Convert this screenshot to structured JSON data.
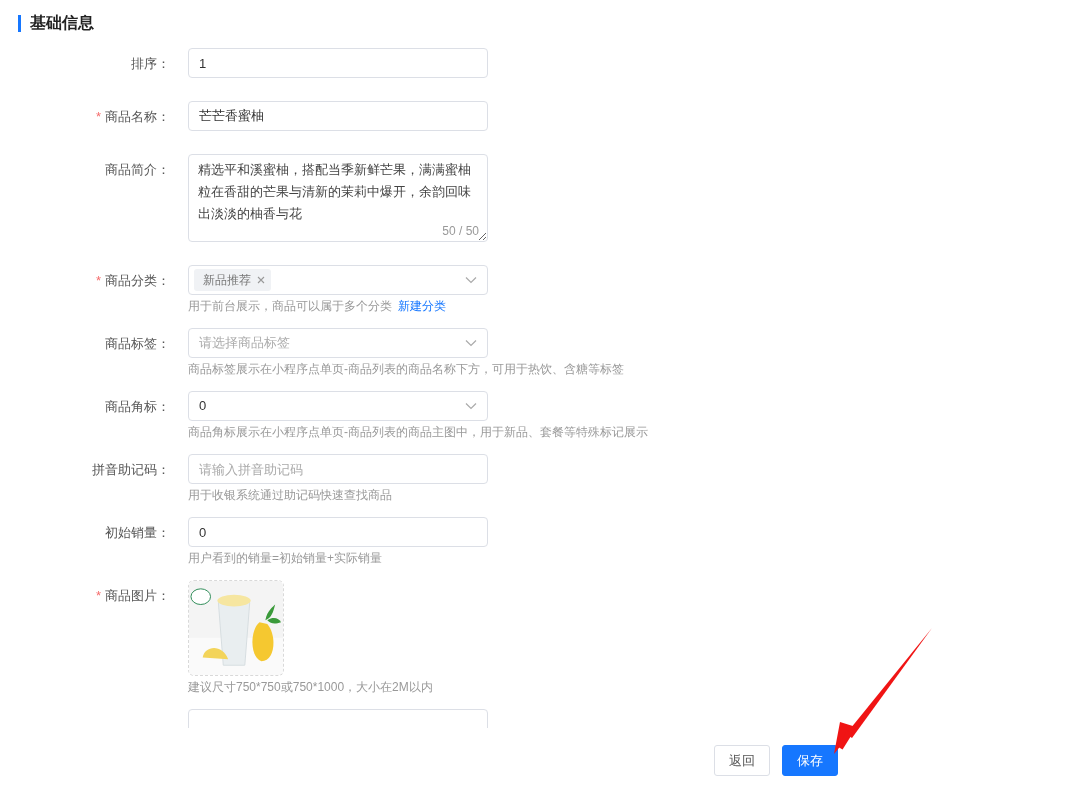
{
  "section_title": "基础信息",
  "fields": [
    {
      "kind": "input",
      "label": "排序：",
      "value": "1"
    },
    {
      "kind": "input",
      "required_mark": "*",
      "label": "商品名称：",
      "value": "芒芒香蜜柚"
    },
    {
      "kind": "textarea",
      "label": "商品简介：",
      "value": "精选平和溪蜜柚，搭配当季新鲜芒果，满满蜜柚粒在香甜的芒果与清新的茉莉中爆开，余韵回味出淡淡的柚香与花",
      "counter": "50 / 50"
    },
    {
      "kind": "tags",
      "required_mark": "*",
      "label": "商品分类：",
      "tags": [
        "新品推荐"
      ],
      "hint": "用于前台展示，商品可以属于多个分类",
      "hint_link": "新建分类"
    },
    {
      "kind": "select",
      "label": "商品标签：",
      "placeholder": "请选择商品标签",
      "hint": "商品标签展示在小程序点单页-商品列表的商品名称下方，可用于热饮、含糖等标签"
    },
    {
      "kind": "select",
      "label": "商品角标：",
      "value": "0",
      "hint": "商品角标展示在小程序点单页-商品列表的商品主图中，用于新品、套餐等特殊标记展示"
    },
    {
      "kind": "input",
      "label": "拼音助记码：",
      "placeholder": "请输入拼音助记码",
      "hint": "用于收银系统通过助记码快速查找商品"
    },
    {
      "kind": "input",
      "label": "初始销量：",
      "value": "0",
      "hint": "用户看到的销量=初始销量+实际销量"
    },
    {
      "kind": "image",
      "required_mark": "*",
      "label": "商品图片：",
      "hint": "建议尺寸750*750或750*1000，大小在2M以内"
    },
    {
      "kind": "input"
    }
  ],
  "buttons": [
    {
      "label": "返回",
      "kind": "default"
    },
    {
      "label": "保存",
      "kind": "primary"
    }
  ]
}
